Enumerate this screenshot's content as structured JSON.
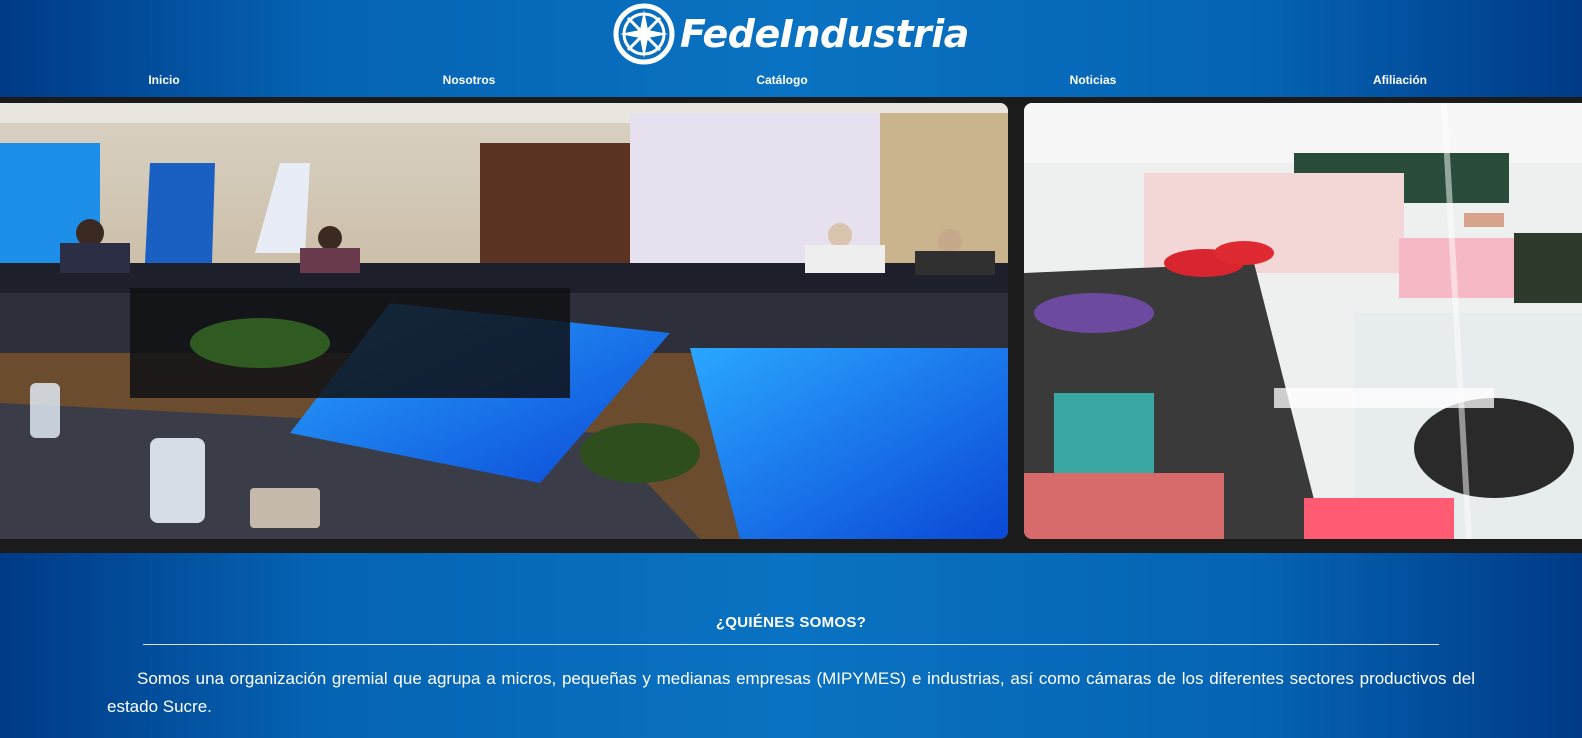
{
  "brand": {
    "name": "FedeIndustria",
    "logo_icon": "compass-rose-logo-icon"
  },
  "nav": {
    "items": [
      {
        "label": "Inicio"
      },
      {
        "label": "Nosotros"
      },
      {
        "label": "Catálogo"
      },
      {
        "label": "Noticias"
      },
      {
        "label": "Afiliación"
      }
    ]
  },
  "gallery": {
    "images": [
      {
        "name": "forum-meeting-photo",
        "icon": "photo-icon"
      },
      {
        "name": "workshop-meeting-photo",
        "icon": "photo-icon"
      }
    ]
  },
  "about": {
    "title": "¿QUIÉNES SOMOS?",
    "text": "Somos una organización gremial que agrupa a micros, pequeñas y medianas empresas (MIPYMES) e industrias, así como cámaras de los diferentes sectores productivos del estado Sucre."
  },
  "colors": {
    "brand_blue": "#0a72c2",
    "dark_blue": "#003a86",
    "gallery_bg": "#1b1b1b",
    "text": "#ffffff"
  }
}
